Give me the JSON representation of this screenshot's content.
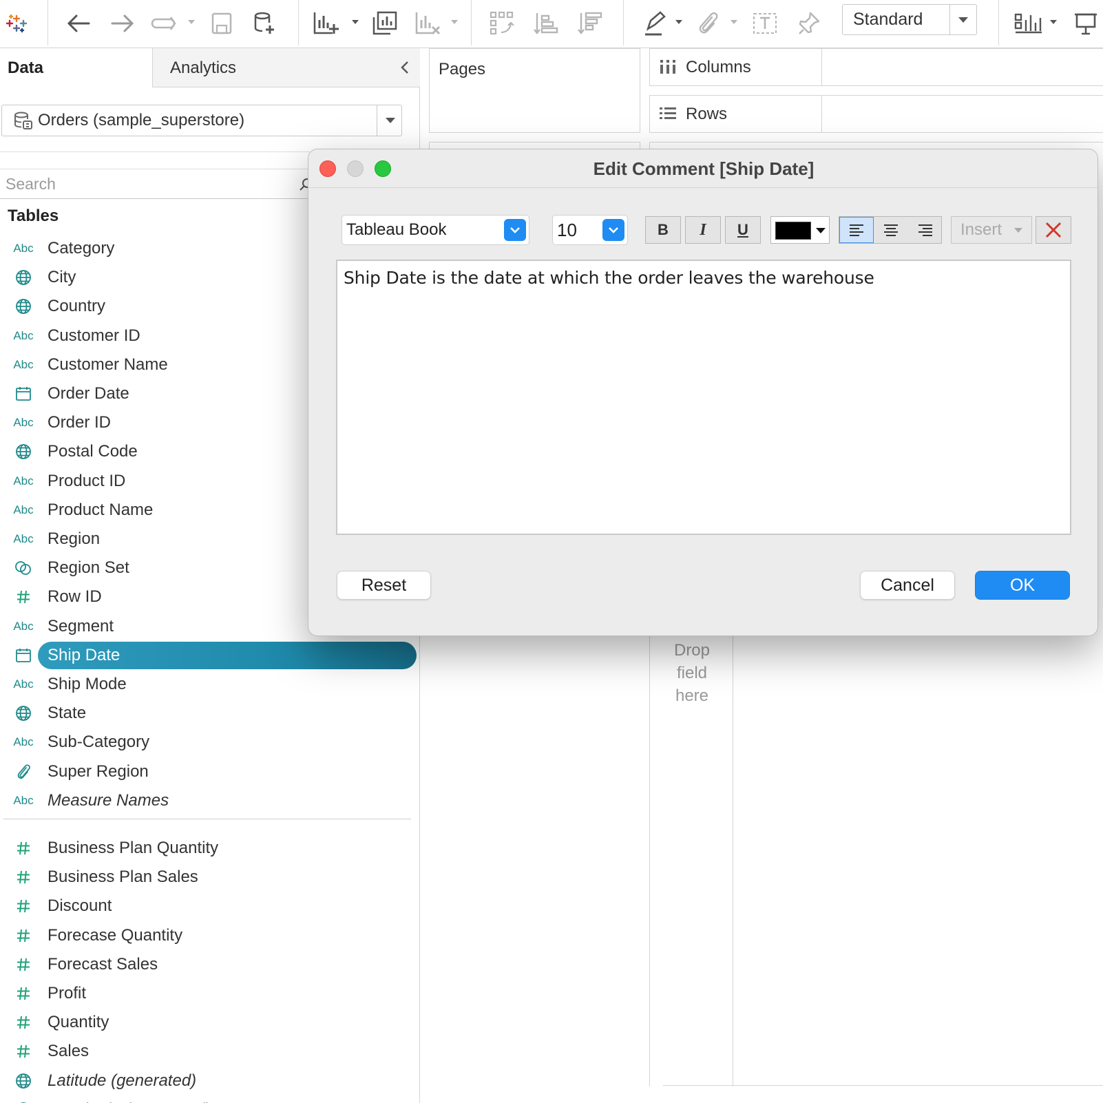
{
  "toolbar": {
    "mark_mode": "Standard",
    "icons": [
      "tableau-logo-icon",
      "undo-icon",
      "redo-icon",
      "replay-icon",
      "save-icon",
      "new-datasource-icon",
      "new-worksheet-icon",
      "duplicate-sheet-icon",
      "clear-sheet-icon",
      "swap-icon",
      "sort-ascending-icon",
      "sort-descending-icon",
      "highlight-icon",
      "annotate-icon",
      "show-labels-icon",
      "pin-icon",
      "show-me-icon",
      "presentation-icon"
    ]
  },
  "data_pane": {
    "tab_data": "Data",
    "tab_analytics": "Analytics",
    "datasource": "Orders (sample_superstore)",
    "search_placeholder": "Search",
    "tables_heading": "Tables",
    "fields": [
      {
        "type": "abc",
        "name": "Category"
      },
      {
        "type": "geo",
        "name": "City"
      },
      {
        "type": "geo",
        "name": "Country"
      },
      {
        "type": "abc",
        "name": "Customer ID"
      },
      {
        "type": "abc",
        "name": "Customer Name"
      },
      {
        "type": "date",
        "name": "Order Date"
      },
      {
        "type": "abc",
        "name": "Order ID"
      },
      {
        "type": "geo",
        "name": "Postal Code"
      },
      {
        "type": "abc",
        "name": "Product ID"
      },
      {
        "type": "abc",
        "name": "Product Name"
      },
      {
        "type": "abc",
        "name": "Region"
      },
      {
        "type": "set",
        "name": "Region Set"
      },
      {
        "type": "hash",
        "name": "Row ID"
      },
      {
        "type": "abc",
        "name": "Segment"
      },
      {
        "type": "date",
        "name": "Ship Date",
        "selected": true
      },
      {
        "type": "abc",
        "name": "Ship Mode"
      },
      {
        "type": "geo",
        "name": "State"
      },
      {
        "type": "abc",
        "name": "Sub-Category"
      },
      {
        "type": "clip",
        "name": "Super Region"
      },
      {
        "type": "abc",
        "name": "Measure Names",
        "italic": true
      }
    ],
    "measures": [
      {
        "type": "hash",
        "name": "Business Plan Quantity"
      },
      {
        "type": "hash",
        "name": "Business Plan Sales"
      },
      {
        "type": "hash",
        "name": "Discount"
      },
      {
        "type": "hash",
        "name": "Forecase Quantity"
      },
      {
        "type": "hash",
        "name": "Forecast Sales"
      },
      {
        "type": "hash",
        "name": "Profit"
      },
      {
        "type": "hash",
        "name": "Quantity"
      },
      {
        "type": "hash",
        "name": "Sales"
      },
      {
        "type": "geo",
        "name": "Latitude (generated)",
        "italic": true
      },
      {
        "type": "geo",
        "name": "Longitude (generated)",
        "italic": true
      }
    ]
  },
  "shelves": {
    "pages": "Pages",
    "columns": "Columns",
    "rows": "Rows",
    "drop_hint": "Drop\nfield\nhere"
  },
  "dialog": {
    "title": "Edit Comment [Ship Date]",
    "font": "Tableau Book",
    "font_size": "10",
    "bold": "B",
    "italic": "I",
    "underline": "U",
    "color": "#000000",
    "alignment": "left",
    "insert": "Insert",
    "comment_text": "Ship Date is the date at which the order leaves the warehouse",
    "reset": "Reset",
    "cancel": "Cancel",
    "ok": "OK"
  },
  "colors": {
    "selection": "#1e88a8",
    "accent_blue": "#1f8cf3",
    "field_icon": "#1f8a8a"
  }
}
